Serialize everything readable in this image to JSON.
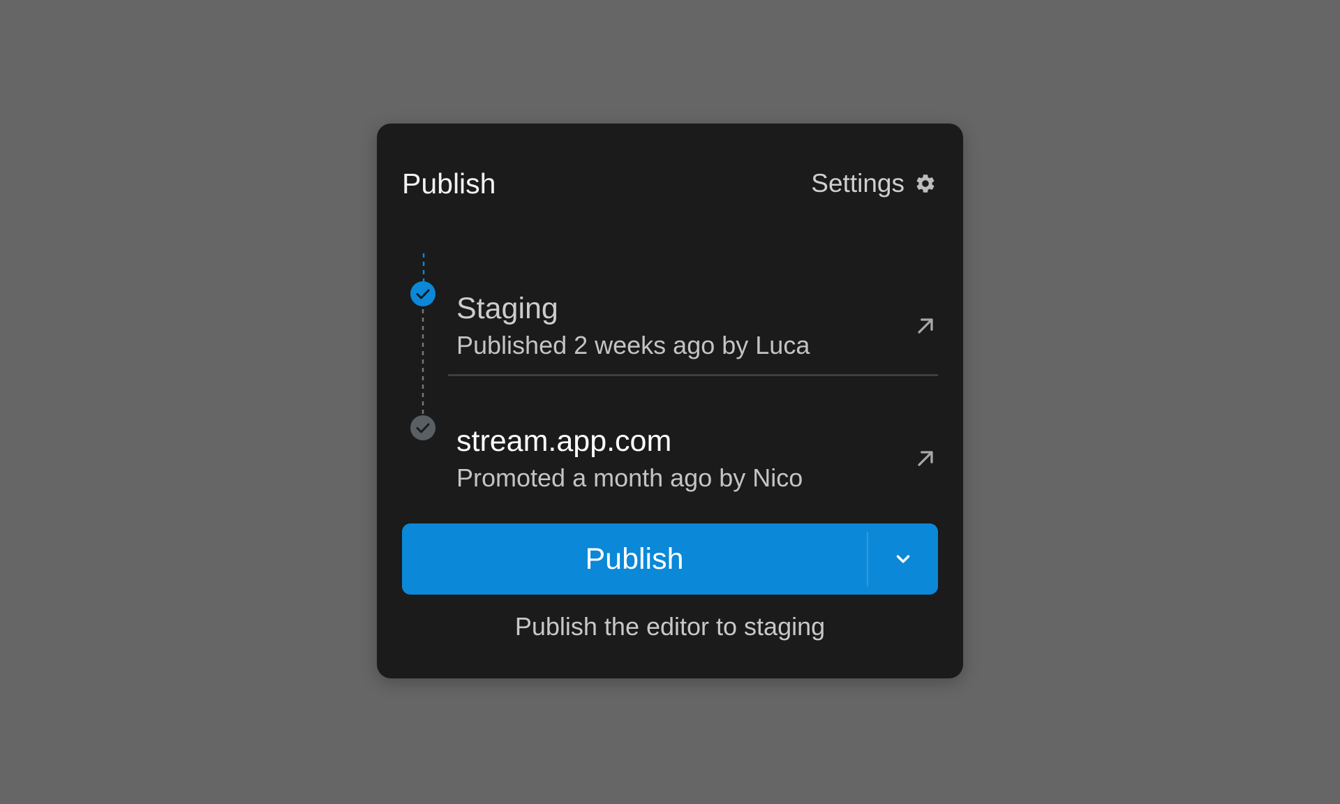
{
  "panel": {
    "title": "Publish",
    "settings_label": "Settings",
    "settings_icon": "gear-icon"
  },
  "environments": [
    {
      "name": "Staging",
      "meta": "Published 2 weeks ago by Luca",
      "status": "current",
      "status_color": "#0b88d8",
      "icon": "arrow-up-right-icon"
    },
    {
      "name": "stream.app.com",
      "meta": "Promoted a month ago by Nico",
      "status": "previous",
      "status_color": "#595f63",
      "icon": "arrow-up-right-icon"
    }
  ],
  "publish_button": {
    "label": "Publish",
    "menu_icon": "chevron-down-icon",
    "color": "#0b88d8"
  },
  "hint": "Publish the editor to staging",
  "colors": {
    "background": "#666666",
    "panel": "#1b1b1b",
    "accent": "#0b88d8"
  }
}
